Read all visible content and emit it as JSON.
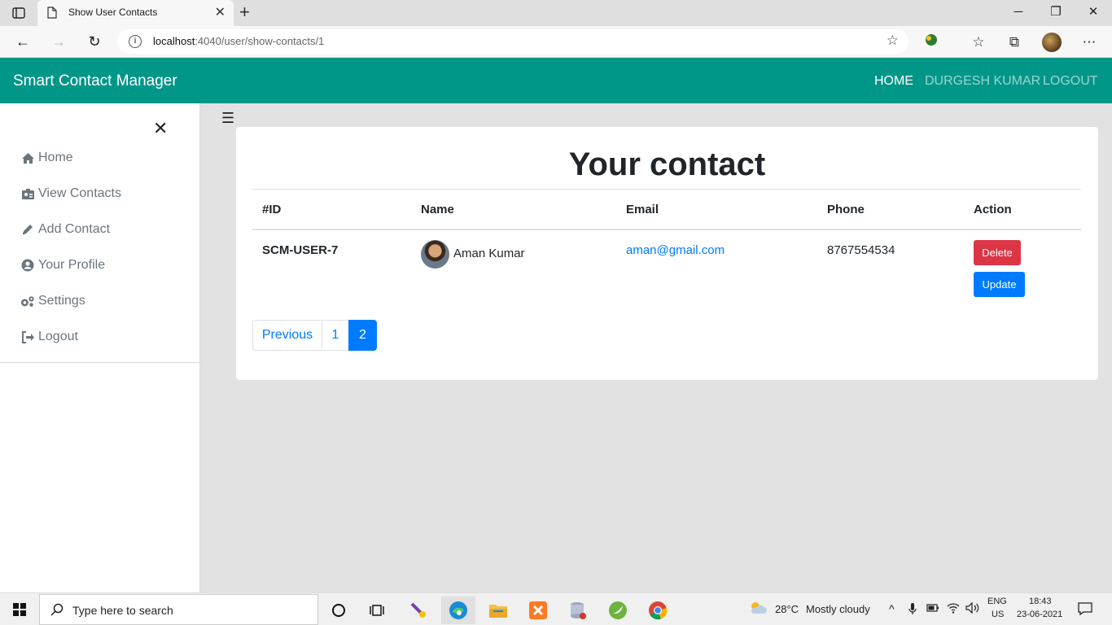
{
  "browser": {
    "tab_title": "Show User Contacts",
    "url_host": "localhost",
    "url_path": ":4040/user/show-contacts/1"
  },
  "navbar": {
    "brand": "Smart Contact Manager",
    "links": [
      "HOME",
      "DURGESH KUMAR",
      "LOGOUT"
    ]
  },
  "sidebar": {
    "items": [
      {
        "label": "Home",
        "icon": "home-icon"
      },
      {
        "label": "View Contacts",
        "icon": "id-badge-icon"
      },
      {
        "label": "Add Contact",
        "icon": "pencil-icon"
      },
      {
        "label": "Your Profile",
        "icon": "user-circle-icon"
      },
      {
        "label": "Settings",
        "icon": "cogs-icon"
      },
      {
        "label": "Logout",
        "icon": "sign-out-icon"
      }
    ]
  },
  "main": {
    "title": "Your contact",
    "columns": [
      "#ID",
      "Name",
      "Email",
      "Phone",
      "Action"
    ],
    "rows": [
      {
        "id": "SCM-USER-7",
        "name": "Aman Kumar",
        "email": "aman@gmail.com",
        "phone": "8767554534",
        "delete_label": "Delete",
        "update_label": "Update"
      }
    ],
    "pagination": {
      "previous": "Previous",
      "pages": [
        "1",
        "2"
      ],
      "current": "2"
    }
  },
  "taskbar": {
    "search_placeholder": "Type here to search",
    "temperature": "28°C",
    "weather": "Mostly cloudy",
    "lang_top": "ENG",
    "lang_bottom": "US",
    "time": "18:43",
    "date": "23-06-2021"
  },
  "colors": {
    "navbar": "#009688",
    "delete": "#dc3545",
    "update": "#007bff",
    "link": "#007bff"
  }
}
